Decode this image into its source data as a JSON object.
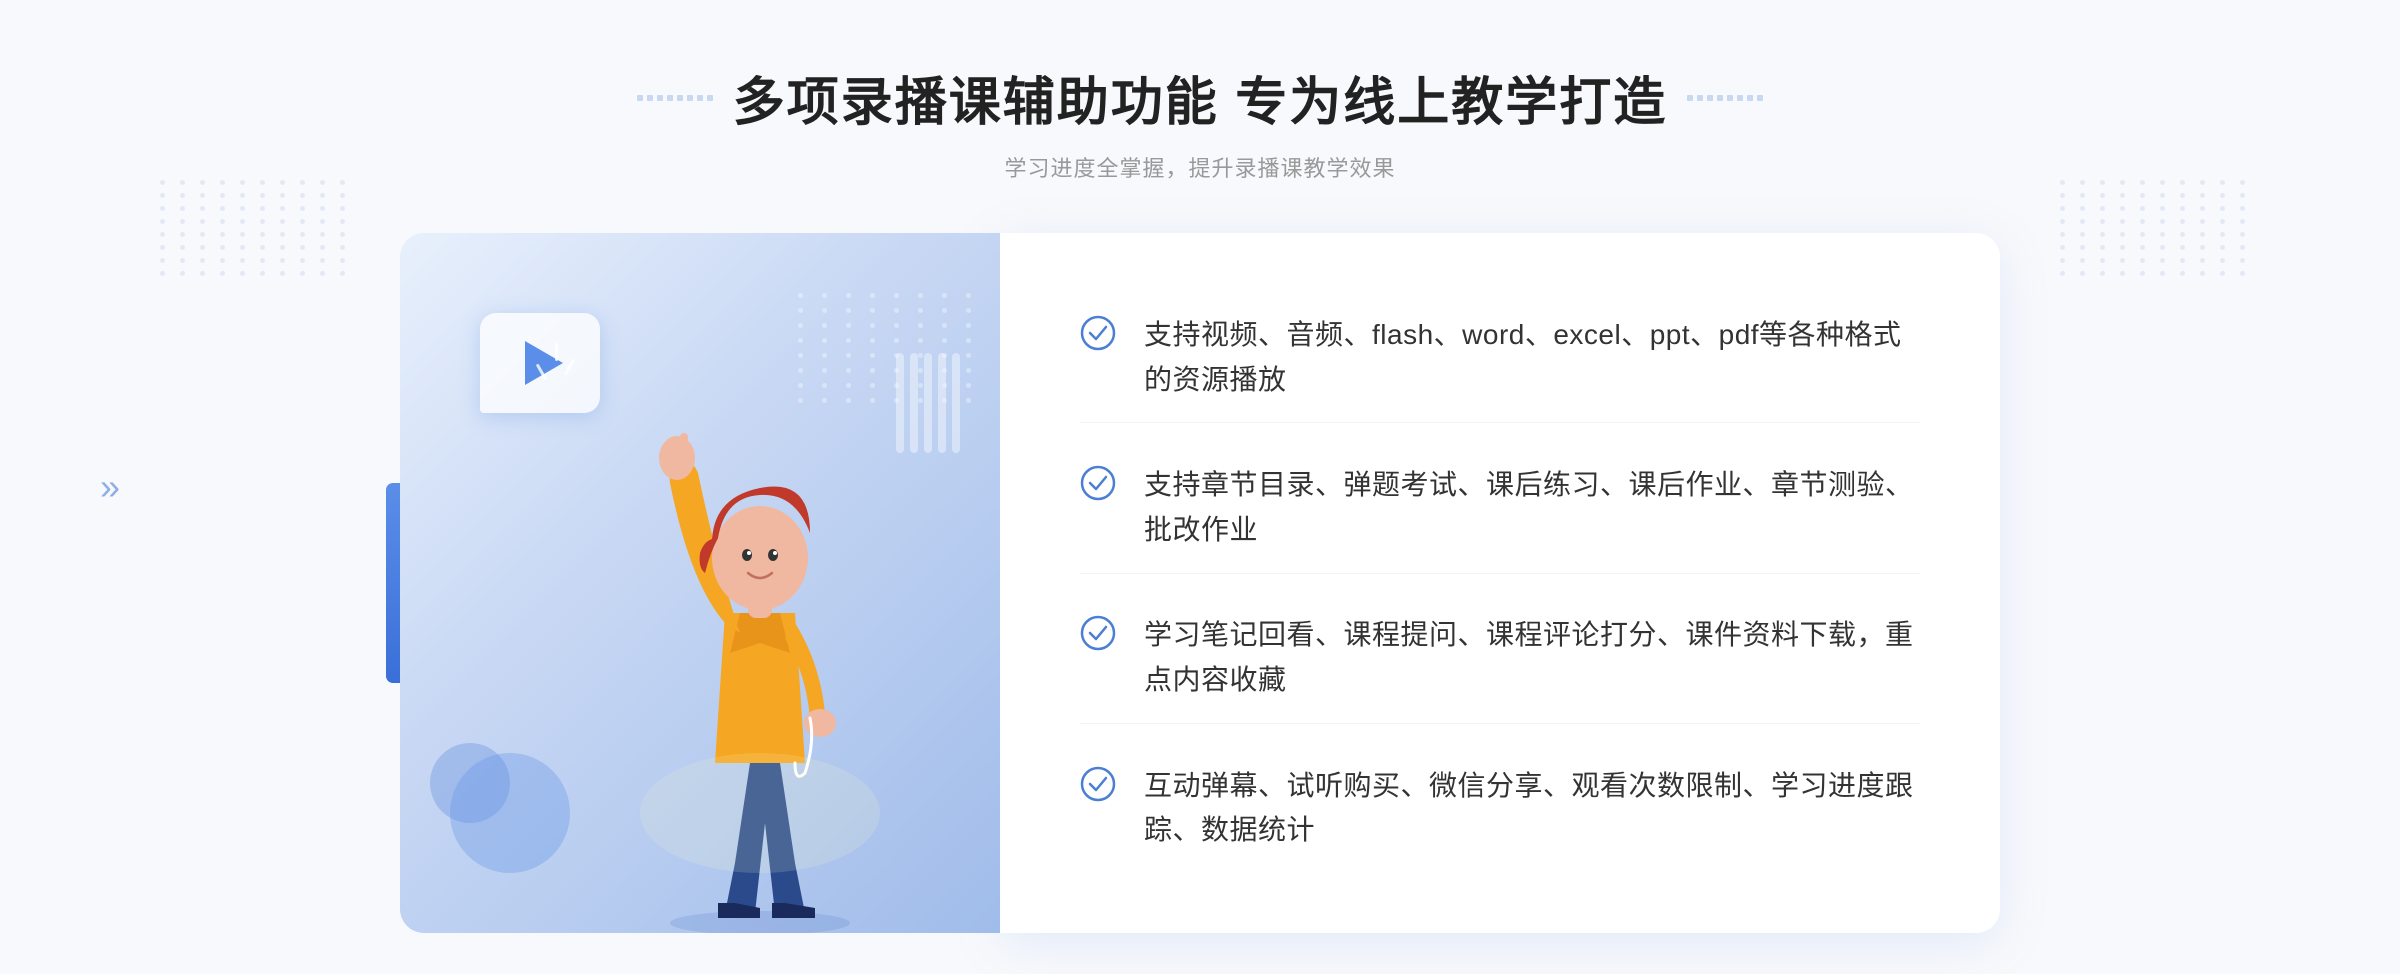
{
  "header": {
    "title": "多项录播课辅助功能 专为线上教学打造",
    "subtitle": "学习进度全掌握，提升录播课教学效果",
    "title_decorator_left": "❖",
    "title_decorator_right": "❖"
  },
  "features": [
    {
      "id": 1,
      "text": "支持视频、音频、flash、word、excel、ppt、pdf等各种格式的资源播放"
    },
    {
      "id": 2,
      "text": "支持章节目录、弹题考试、课后练习、课后作业、章节测验、批改作业"
    },
    {
      "id": 3,
      "text": "学习笔记回看、课程提问、课程评论打分、课件资料下载，重点内容收藏"
    },
    {
      "id": 4,
      "text": "互动弹幕、试听购买、微信分享、观看次数限制、学习进度跟踪、数据统计"
    }
  ],
  "colors": {
    "accent": "#4a7fd4",
    "title": "#222222",
    "subtitle": "#999999",
    "feature_text": "#333333",
    "check_color": "#4a7fd4",
    "bg": "#f8f9fc",
    "panel_bg": "#ffffff"
  }
}
